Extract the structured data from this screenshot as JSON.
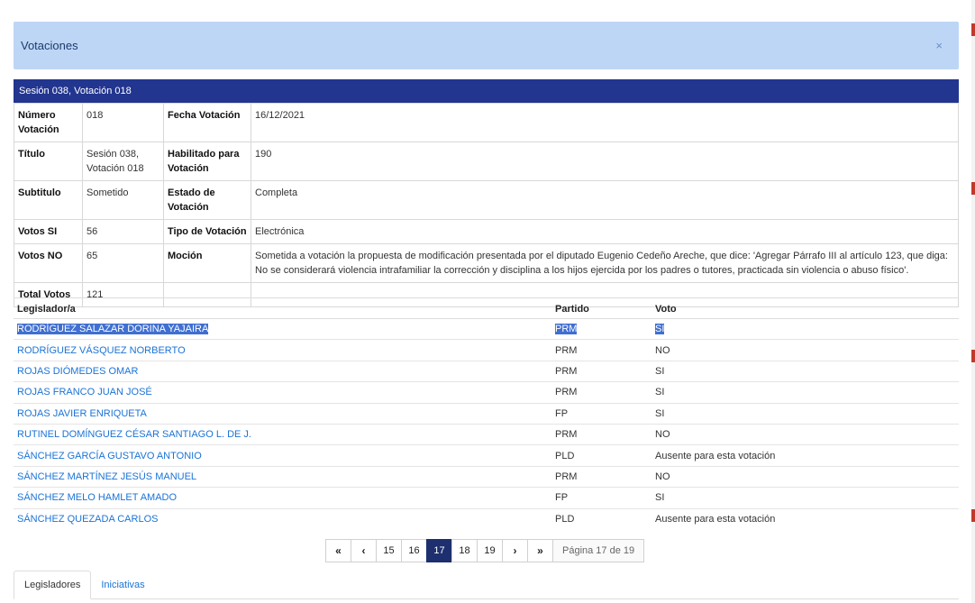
{
  "modal": {
    "title": "Votaciones",
    "close": "×"
  },
  "session_bar": "Sesión 038, Votación 018",
  "info": {
    "numero_label": "Número Votación",
    "numero": "018",
    "fecha_label": "Fecha Votación",
    "fecha": "16/12/2021",
    "titulo_label": "Título",
    "titulo": "Sesión 038, Votación 018",
    "habilitado_label": "Habilitado para Votación",
    "habilitado": "190",
    "subtitulo_label": "Subtitulo",
    "subtitulo": "Sometido",
    "estado_label": "Estado de Votación",
    "estado": "Completa",
    "si_label": "Votos SI",
    "si": "56",
    "tipo_label": "Tipo de Votación",
    "tipo": "Electrónica",
    "no_label": "Votos NO",
    "no": "65",
    "mocion_label": "Moción",
    "mocion": "Sometida a votación la propuesta de modificación presentada por el diputado Eugenio Cedeño Areche, que dice: 'Agregar Párrafo III al artículo 123, que diga: No se considerará violencia intrafamiliar la corrección y disciplina a los hijos ejercida por los padres o tutores, practicada sin violencia o abuso físico'.",
    "total_label": "Total Votos",
    "total": "121"
  },
  "legislators": {
    "headers": [
      "Legislador/a",
      "Partido",
      "Voto"
    ],
    "rows": [
      {
        "name": "RODRÍGUEZ SALAZAR DORINA YAJAIRA",
        "party": "PRM",
        "vote": "SI"
      },
      {
        "name": "RODRÍGUEZ VÁSQUEZ NORBERTO",
        "party": "PRM",
        "vote": "NO"
      },
      {
        "name": "ROJAS DIÓMEDES OMAR",
        "party": "PRM",
        "vote": "SI"
      },
      {
        "name": "ROJAS FRANCO JUAN JOSÉ",
        "party": "PRM",
        "vote": "SI"
      },
      {
        "name": "ROJAS JAVIER ENRIQUETA",
        "party": "FP",
        "vote": "SI"
      },
      {
        "name": "RUTINEL DOMÍNGUEZ CÉSAR SANTIAGO L. DE J.",
        "party": "PRM",
        "vote": "NO"
      },
      {
        "name": "SÁNCHEZ GARCÍA GUSTAVO ANTONIO",
        "party": "PLD",
        "vote": "Ausente para esta votación"
      },
      {
        "name": "SÁNCHEZ MARTÍNEZ JESÚS MANUEL",
        "party": "PRM",
        "vote": "NO"
      },
      {
        "name": "SÁNCHEZ MELO HAMLET AMADO",
        "party": "FP",
        "vote": "SI"
      },
      {
        "name": "SÁNCHEZ QUEZADA CARLOS",
        "party": "PLD",
        "vote": "Ausente para esta votación"
      }
    ]
  },
  "pager": {
    "first": "«",
    "prev": "‹",
    "next": "›",
    "last": "»",
    "pages": [
      "15",
      "16",
      "17",
      "18",
      "19"
    ],
    "current": "17",
    "info": "Página 17 de 19"
  },
  "tabs": [
    "Legisladores",
    "Iniciativas"
  ]
}
